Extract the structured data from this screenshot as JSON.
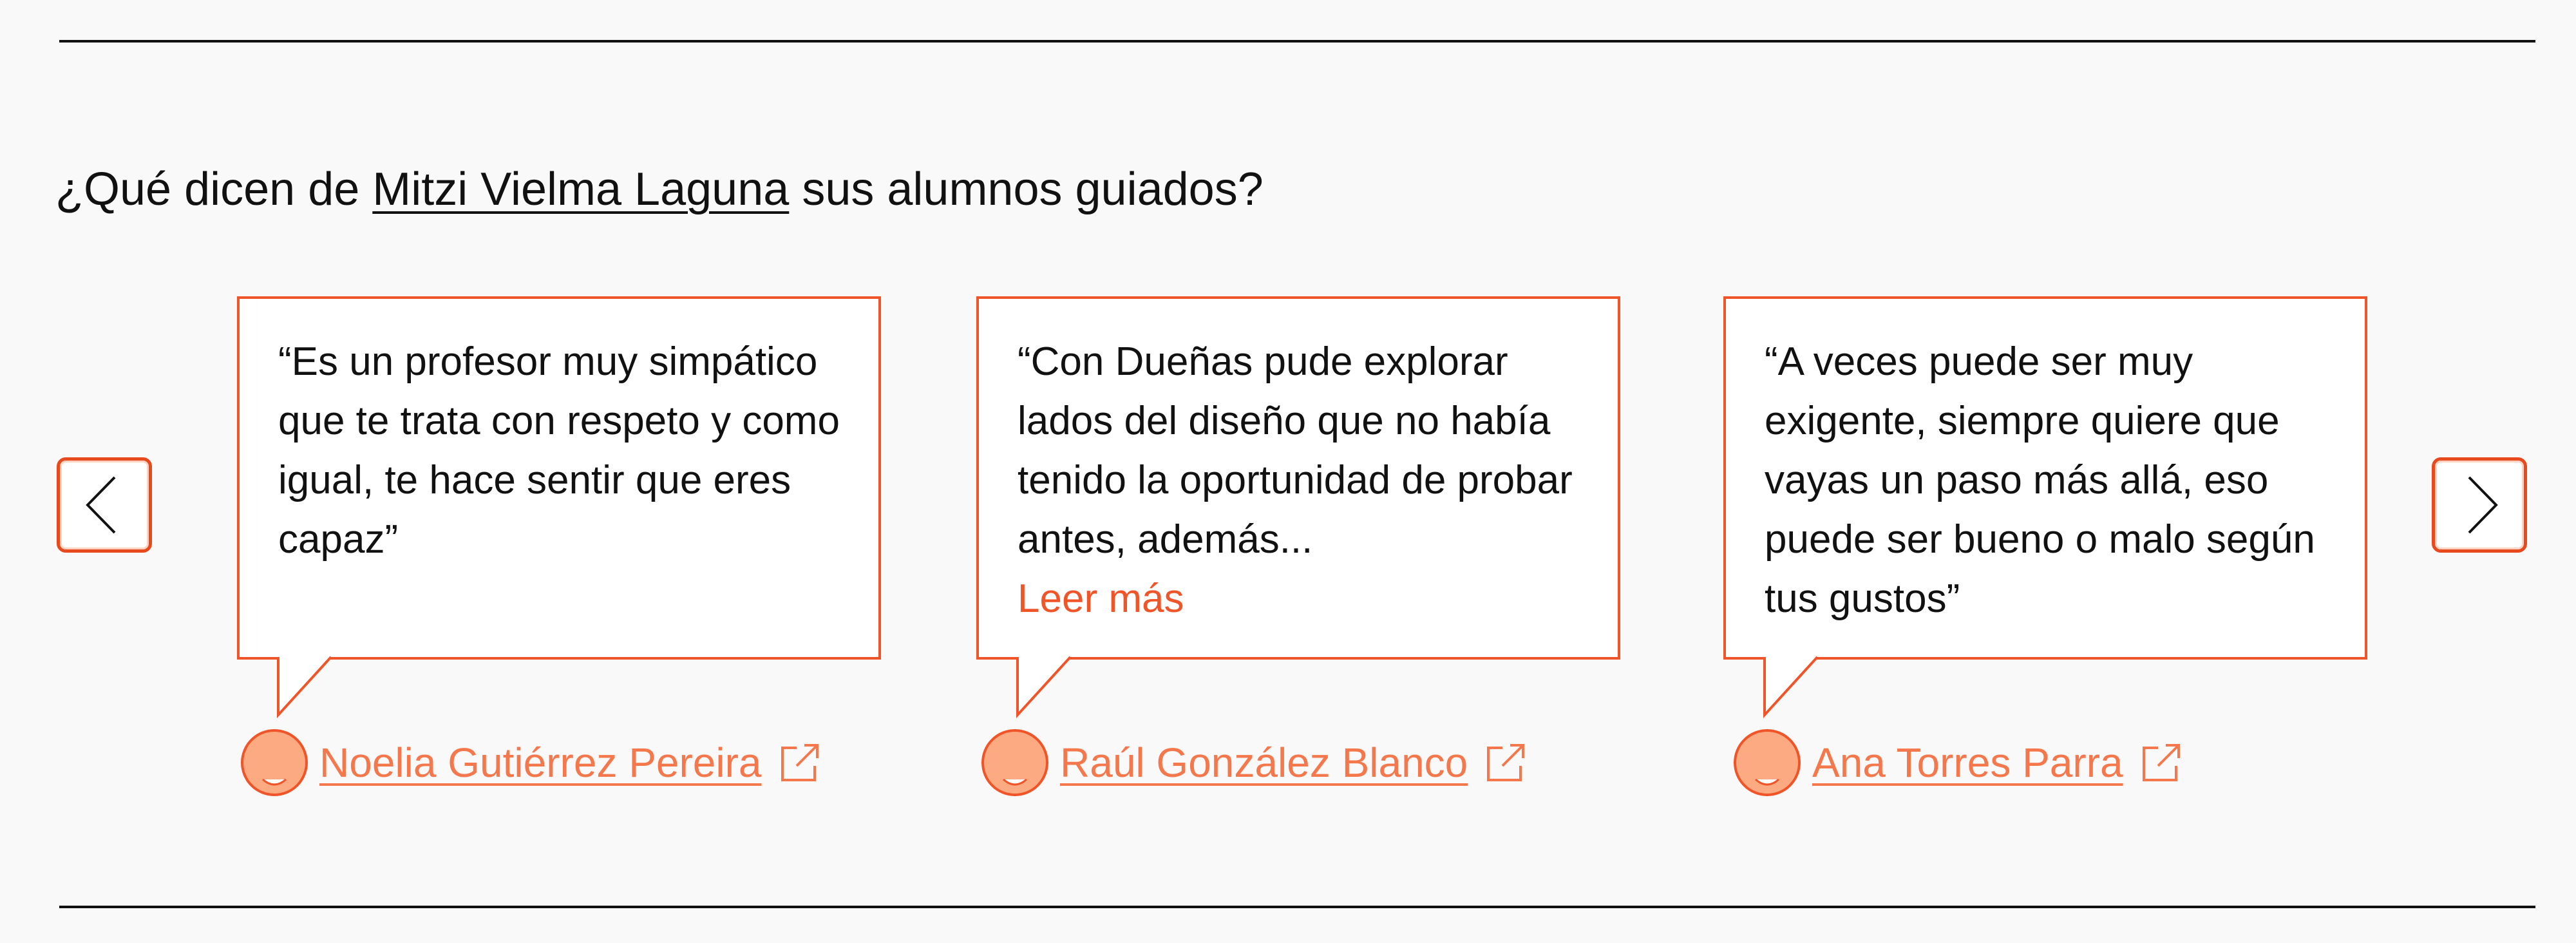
{
  "heading": {
    "prefix": "¿Qué dicen de ",
    "mentor_name": "Mitzi Vielma Laguna",
    "suffix": " sus alumnos guiados?"
  },
  "carousel": {
    "prev_icon": "chevron-left-icon",
    "next_icon": "chevron-right-icon",
    "testimonials": [
      {
        "quote": "“Es un profesor muy simpático que te trata con respeto y como igual, te hace sentir que eres capaz”",
        "read_more": "",
        "author": "Noelia Gutiérrez Pereira",
        "external_icon": "external-link-icon"
      },
      {
        "quote": "“Con Dueñas pude explorar lados del diseño que no había tenido la oportunidad de probar antes, además...",
        "read_more": "Leer más",
        "author": "Raúl González Blanco",
        "external_icon": "external-link-icon"
      },
      {
        "quote": "“A veces puede ser muy exigente, siempre quiere que vayas un paso más allá, eso puede ser bueno o malo según tus gustos”",
        "read_more": "",
        "author": "Ana Torres Parra",
        "external_icon": "external-link-icon"
      }
    ]
  },
  "colors": {
    "accent": "#f0552a",
    "author_link": "#f4784c",
    "avatar_fill": "#fcaa82",
    "text": "#111111",
    "background": "#f9f9f9"
  }
}
